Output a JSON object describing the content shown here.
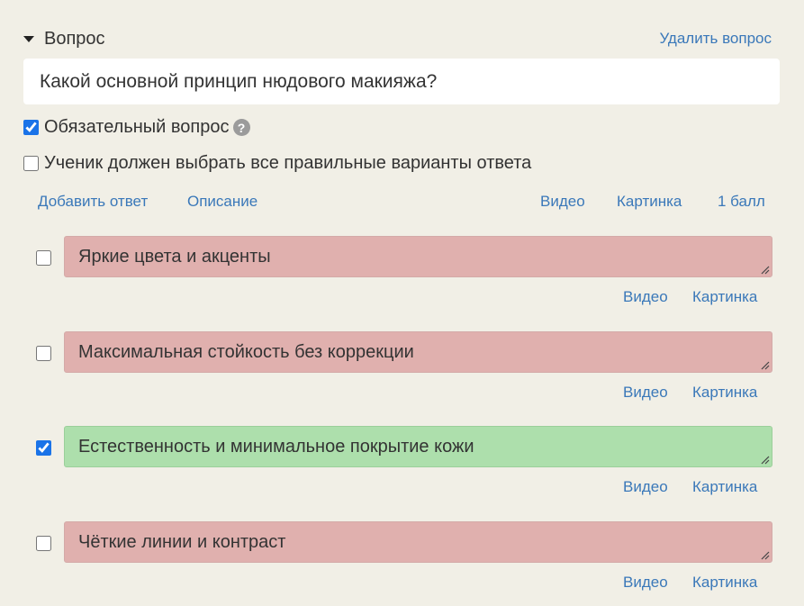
{
  "question": {
    "section_title": "Вопрос",
    "delete_label": "Удалить вопрос",
    "text": "Какой основной принцип нюдового макияжа?",
    "required_label": "Обязательный вопрос",
    "required_checked": true,
    "all_correct_label": "Ученик должен выбрать все правильные варианты ответа",
    "all_correct_checked": false
  },
  "toolbar": {
    "add_answer": "Добавить ответ",
    "description": "Описание",
    "video": "Видео",
    "picture": "Картинка",
    "points": "1 балл"
  },
  "answers": [
    {
      "text": "Яркие цвета и акценты",
      "checked": false,
      "video": "Видео",
      "picture": "Картинка"
    },
    {
      "text": "Максимальная стойкость без коррекции",
      "checked": false,
      "video": "Видео",
      "picture": "Картинка"
    },
    {
      "text": "Естественность и минимальное покрытие кожи",
      "checked": true,
      "video": "Видео",
      "picture": "Картинка"
    },
    {
      "text": "Чёткие линии и контраст",
      "checked": false,
      "video": "Видео",
      "picture": "Картинка"
    }
  ],
  "colors": {
    "background": "#f1efe6",
    "link": "#3a78b9",
    "incorrect_answer": "#e0b0ae",
    "correct_answer": "#addfac"
  },
  "icons": [
    "caret-down-icon",
    "question-help-icon",
    "resize-handle-icon"
  ]
}
